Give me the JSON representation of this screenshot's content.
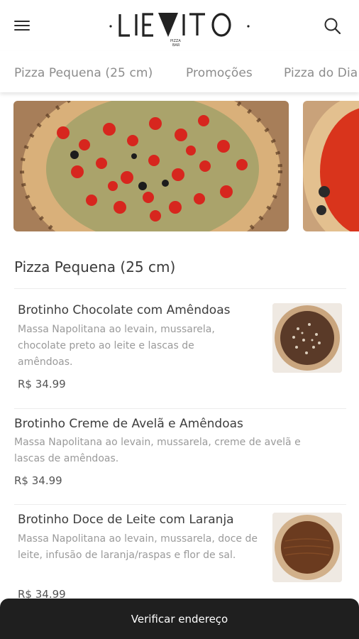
{
  "header": {
    "logo_text": "LIEVITO",
    "logo_sub_1": "PIZZA",
    "logo_sub_2": "BAR",
    "menu_icon": "hamburger-menu-icon",
    "search_icon": "search-icon"
  },
  "tabs": [
    {
      "label": "Pizza Pequena (25 cm)"
    },
    {
      "label": "Promoções"
    },
    {
      "label": "Pizza do Dia"
    }
  ],
  "carousel": {
    "banners": [
      {
        "subject": "pizza with cherry tomatoes and pesto"
      },
      {
        "subject": "pizza with tomato sauce"
      }
    ]
  },
  "section": {
    "title": "Pizza Pequena (25 cm)"
  },
  "items": [
    {
      "name": "Brotinho Chocolate com Amêndoas",
      "description": "Massa Napolitana ao levain, mussarela, chocolate preto ao leite e lascas de amêndoas.",
      "price": "R$ 34.99",
      "has_image": true
    },
    {
      "name": "Brotinho Creme de Avelã e Amêndoas",
      "description": "Massa Napolitana ao levain, mussarela, creme de avelã e lascas de amêndoas.",
      "price": "R$ 34.99",
      "has_image": false
    },
    {
      "name": "Brotinho Doce de Leite com Laranja",
      "description": "Massa Napolitana ao levain, mussarela, doce de leite, infusão de laranja/raspas e flor de sal.",
      "price": "R$ 34.99",
      "has_image": true
    }
  ],
  "bottom_bar": {
    "label": "Verificar endereço"
  },
  "colors": {
    "bottom_bar_bg": "#1f1f1f",
    "text_primary": "#3d3d3d",
    "text_secondary": "#9a9a9a"
  }
}
